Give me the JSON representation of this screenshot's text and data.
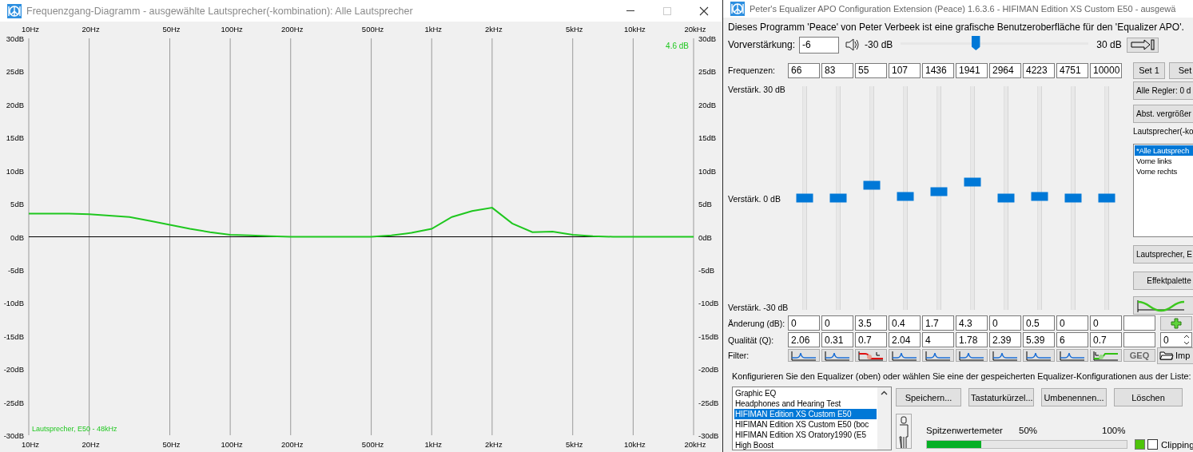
{
  "freq_window": {
    "title": "Frequenzgang-Diagramm - ausgewählte Lautsprecher(-kombination): Alle Lautsprecher",
    "peak_label": "4.6 dB",
    "chart_data": {
      "type": "line",
      "grid": true,
      "categories": [
        "10Hz",
        null,
        null,
        "20Hz",
        null,
        null,
        null,
        "50Hz",
        null,
        null,
        "100Hz",
        null,
        null,
        "200Hz",
        null,
        null,
        null,
        "500Hz",
        null,
        null,
        "1kHz",
        null,
        null,
        "2kHz",
        null,
        null,
        null,
        "5kHz",
        null,
        null,
        "10kHz",
        null,
        null,
        "20kHz"
      ],
      "series": [
        {
          "name": "Lautsprecher, E50 - 48kHz",
          "color": "#1fc71f",
          "values": [
            3.5,
            3.5,
            3.5,
            3.4,
            3.2,
            3.0,
            2.4,
            1.8,
            1.2,
            0.7,
            0.3,
            0.2,
            0.1,
            0,
            0,
            0,
            0,
            0,
            0.2,
            0.6,
            1.2,
            3.0,
            3.9,
            4.4,
            2.0,
            0.7,
            0.8,
            0.3,
            0.1,
            0,
            0,
            0,
            0,
            0
          ]
        }
      ],
      "ylim": [
        -30,
        30
      ],
      "yticks": [
        {
          "value": 30,
          "label": "30dB"
        },
        {
          "value": 25,
          "label": "25dB"
        },
        {
          "value": 20,
          "label": "20dB"
        },
        {
          "value": 15,
          "label": "15dB"
        },
        {
          "value": 10,
          "label": "10dB"
        },
        {
          "value": 5,
          "label": "5dB"
        },
        {
          "value": 0,
          "label": "0dB"
        },
        {
          "value": -5,
          "label": "-5dB"
        },
        {
          "value": -10,
          "label": "-10dB"
        },
        {
          "value": -15,
          "label": "-15dB"
        },
        {
          "value": -20,
          "label": "-20dB"
        },
        {
          "value": -25,
          "label": "-25dB"
        },
        {
          "value": -30,
          "label": "-30dB"
        }
      ]
    }
  },
  "eq_window": {
    "title": "Peter's Equalizer APO Configuration Extension (Peace) 1.6.3.6 - HIFIMAN Edition XS Custom E50 - ausgewä",
    "intro": "Dieses Programm 'Peace' von Peter Verbeek ist eine grafische Benutzeroberfläche für den 'Equalizer APO'.",
    "preamp": {
      "label": "Vorverstärkung:",
      "value": "-6",
      "min_label": "-30 dB",
      "max_label": "30 dB",
      "level": 0.4
    },
    "freq_label": "Frequenzen:",
    "set_buttons": [
      "Set 1",
      "Set"
    ],
    "gain_scale": [
      "Verstärk. 30 dB",
      "Verstärk. 0 dB",
      "Verstärk. -30 dB"
    ],
    "gain_label": "Änderung (dB):",
    "q_label": "Qualität (Q):",
    "filter_label": "Filter:",
    "bands": [
      {
        "frequency": "66",
        "gain": "0",
        "q": "2.06",
        "kind": "peak",
        "level": 0.5
      },
      {
        "frequency": "83",
        "gain": "0",
        "q": "0.31",
        "kind": "peak",
        "level": 0.5
      },
      {
        "frequency": "55",
        "gain": "3.5",
        "q": "0.7",
        "kind": "lowshelf",
        "level": 0.558
      },
      {
        "frequency": "107",
        "gain": "0.4",
        "q": "2.04",
        "kind": "peak",
        "level": 0.507
      },
      {
        "frequency": "1436",
        "gain": "1.7",
        "q": "4",
        "kind": "peak",
        "level": 0.528
      },
      {
        "frequency": "1941",
        "gain": "4.3",
        "q": "1.78",
        "kind": "peak",
        "level": 0.572
      },
      {
        "frequency": "2964",
        "gain": "0",
        "q": "2.39",
        "kind": "peak",
        "level": 0.5
      },
      {
        "frequency": "4223",
        "gain": "0.5",
        "q": "5.39",
        "kind": "peak",
        "level": 0.508
      },
      {
        "frequency": "4751",
        "gain": "0",
        "q": "6",
        "kind": "peak",
        "level": 0.5
      },
      {
        "frequency": "10000",
        "gain": "0",
        "q": "0.7",
        "kind": "highshelf",
        "level": 0.5
      }
    ],
    "q_spin_value": "0",
    "geq_button": "GEQ",
    "import_button": "Imp",
    "side_buttons": [
      "Alle Regler: 0 d",
      "Abst. vergrößer"
    ],
    "speaker_label": "Lautsprecher(-ko",
    "speakers": [
      {
        "label": "*Alle Lautsprech",
        "selected": true
      },
      {
        "label": "Vorne links",
        "selected": false
      },
      {
        "label": "Vorne rechts",
        "selected": false
      }
    ],
    "speaker_button": "Lautsprecher, E",
    "effects_button": "Effektpalette",
    "config_text": "Konfigurieren Sie den Equalizer (oben) oder wählen Sie eine der gespeicherten Equalizer-Konfigurationen aus der Liste:",
    "configs": [
      {
        "label": "Graphic EQ",
        "selected": false
      },
      {
        "label": "Headphones and Hearing Test",
        "selected": false
      },
      {
        "label": "HIFIMAN Edition XS Custom E50",
        "selected": true
      },
      {
        "label": "HIFIMAN Edition XS Custom E50 (boc",
        "selected": false
      },
      {
        "label": "HIFIMAN Edition XS Oratory1990 (E5",
        "selected": false
      },
      {
        "label": "High Boost",
        "selected": false
      }
    ],
    "config_buttons": [
      "Speichern...",
      "Tastaturkürzel...",
      "Umbenennen...",
      "Löschen"
    ],
    "peak_meter": {
      "label": "Spitzenwertemeter",
      "mid_label": "50%",
      "max_label": "100%",
      "level": 0.27,
      "clipping_label": "Clipping",
      "clipping_checked": false
    }
  }
}
